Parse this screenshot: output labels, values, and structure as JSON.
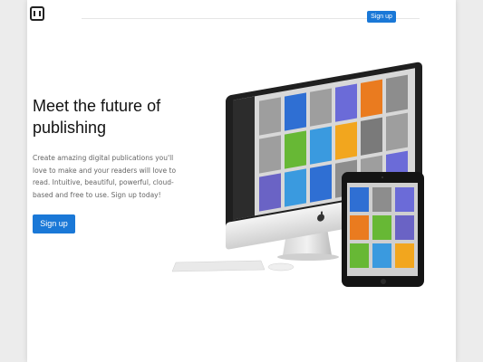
{
  "header": {
    "logo_icon": "chip-icon",
    "signup_label": "Sign up"
  },
  "hero": {
    "title": "Meet the future of publishing",
    "description": "Create amazing digital publications you'll love to make and your readers will love to read. Intuitive, beautiful, powerful, cloud-based and free to use. Sign up today!",
    "cta_label": "Sign up"
  },
  "colors": {
    "accent": "#1a78d7"
  },
  "devices": {
    "monitor_icon": "apple-icon",
    "tablet": {
      "tiles": [
        "#2f6fd3",
        "#8d8d8d",
        "#6b6bd8",
        "#ea7b1f",
        "#67b835",
        "#6a63c5",
        "#67b835",
        "#3a9adf",
        "#f2a61e"
      ]
    },
    "monitor": {
      "tiles_row1": [
        "#9e9e9e",
        "#2f6fd3",
        "#9e9e9e",
        "#6b6bd8",
        "#ea7b1f",
        "#8d8d8d"
      ],
      "tiles_row2": [
        "#9e9e9e",
        "#67b835",
        "#3a9adf",
        "#f2a61e",
        "#7a7a7a",
        "#9e9e9e"
      ],
      "tiles_row3": [
        "#6a63c5",
        "#3a9adf",
        "#2f6fd3",
        "#8d8d8d",
        "#9e9e9e",
        "#6b6bd8"
      ]
    }
  }
}
